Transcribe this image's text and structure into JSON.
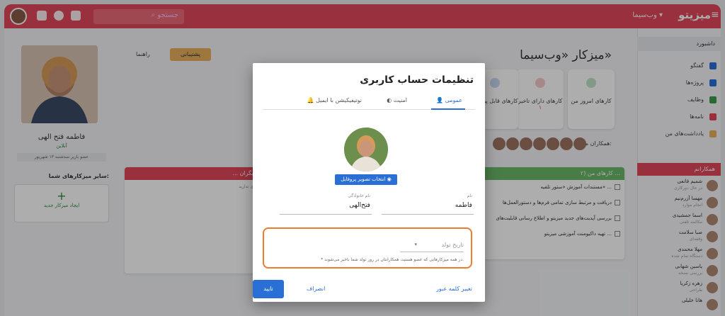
{
  "topbar": {
    "brand": "میزیتو",
    "workspace": "وب‌سیما ▾",
    "search_placeholder": "جستجو"
  },
  "sidebar": {
    "dashboard": "داشبورد",
    "items": [
      {
        "label": "گفتگو"
      },
      {
        "label": "پروژه‌ها"
      },
      {
        "label": "وظایف"
      },
      {
        "label": "نامه‌ها"
      },
      {
        "label": "یادداشت‌های من"
      }
    ],
    "section_colleagues": "همکارانم",
    "users": [
      {
        "name": "شمیم قانعی",
        "status": "در حال دورکاری"
      },
      {
        "name": "مهسا آزرم‌نیم",
        "status": "انجام موارد"
      },
      {
        "name": "اسما جمشیدی",
        "status": "مکالمه تلفنی"
      },
      {
        "name": "صبا سلامت",
        "status": "وقفه‌ای"
      },
      {
        "name": "مهلا محمدی",
        "status": "دستگاه تمام شده"
      },
      {
        "name": "یاسین شهابی",
        "status": "بررسی نسخه"
      },
      {
        "name": "زهره زکریا",
        "status": "طراحی"
      },
      {
        "name": "هانا خلیلی",
        "status": ""
      }
    ]
  },
  "main": {
    "title": "میزکار «وب‌سیما»",
    "support": "پشتیبانی",
    "guide": "راهنما",
    "stats": [
      {
        "label": "کارهای امروز من",
        "value": ""
      },
      {
        "label": "کارهای دارای تاخیر",
        "value": "۱"
      },
      {
        "label": "کارهای قابل پیگیری",
        "value": ""
      }
    ],
    "colleagues_label": "همکاران من:",
    "tasks_head": "کارهای من (۲ ...",
    "tasks": [
      "مستندات آموزش «ستور تلفیه» ...",
      "دریافت و مرتبط سازی تمامی فرم‌ها و دستورالعمل‌ها",
      "بررسی آپدیت‌های جدید میزیتو و اطلاع رسانی قابلیت‌های",
      "تهیه داکیومنت آموزشی میزیتو ..."
    ],
    "others_head": "... از دیگران",
    "others_empty": "پیگیری ندارید"
  },
  "profile": {
    "name": "فاطمه فتح الهی",
    "online": "آنلاین",
    "joined": "عضو بازیر سه‌شنبه ۱۳ شهریور",
    "others_title": "سایر میزکارهای شما:",
    "new_workspace": "ایجاد میزکار جدید"
  },
  "modal": {
    "title": "تنظیمات حساب کاربری",
    "tabs": [
      "عمومی",
      "امنیت",
      "نوتیفیکیشن با ایمیل"
    ],
    "photo_button": "انتخاب تصویر پروفایل",
    "first_name_label": "نام",
    "first_name": "فاطمه",
    "last_name_label": "نام خانوادگی",
    "last_name": "فتح‌الهی",
    "birth_label": "تاریخ تولد",
    "birth_hint": "* در همه میزکارهایی که عضو هستید، همکارانتان در روز تولد شما باخبر می‌شوند.",
    "change_password": "تغییر کلمه عبور",
    "cancel": "انصراف",
    "confirm": "تایید"
  },
  "colors": {
    "brand": "#e0475a",
    "accent": "#2a6fd6",
    "highlight": "#ee7c2d"
  }
}
